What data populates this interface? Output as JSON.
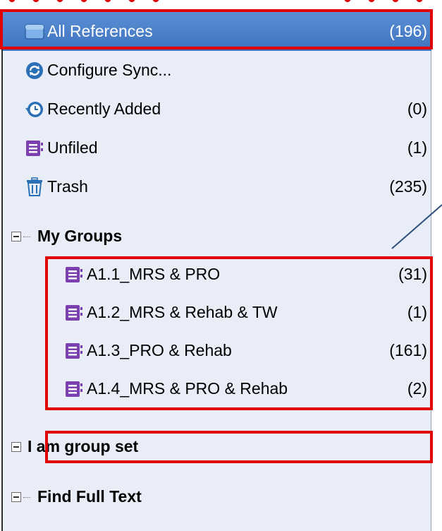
{
  "library": {
    "items": [
      {
        "label": "All References",
        "count": "(196)",
        "icon": "all-references-icon",
        "selected": true
      },
      {
        "label": "Configure Sync...",
        "count": "",
        "icon": "sync-icon"
      },
      {
        "label": "Recently Added",
        "count": "(0)",
        "icon": "recently-added-icon"
      },
      {
        "label": "Unfiled",
        "count": "(1)",
        "icon": "unfiled-icon"
      },
      {
        "label": "Trash",
        "count": "(235)",
        "icon": "trash-icon"
      }
    ]
  },
  "my_groups": {
    "label": "My Groups",
    "items": [
      {
        "label": "A1.1_MRS & PRO",
        "count": "(31)"
      },
      {
        "label": "A1.2_MRS & Rehab & TW",
        "count": "(1)"
      },
      {
        "label": "A1.3_PRO & Rehab",
        "count": "(161)"
      },
      {
        "label": "A1.4_MRS & PRO & Rehab",
        "count": "(2)"
      }
    ]
  },
  "group_set": {
    "label": "I am group set"
  },
  "find_full_text": {
    "label": "Find Full Text"
  },
  "colors": {
    "selection": "#4a80c8",
    "panel": "#e8edf8",
    "highlight_box": "#e00000",
    "group_icon": "#7b3fb0",
    "sync_icon": "#2b6fb6",
    "callout_line": "#2f4f7f"
  }
}
